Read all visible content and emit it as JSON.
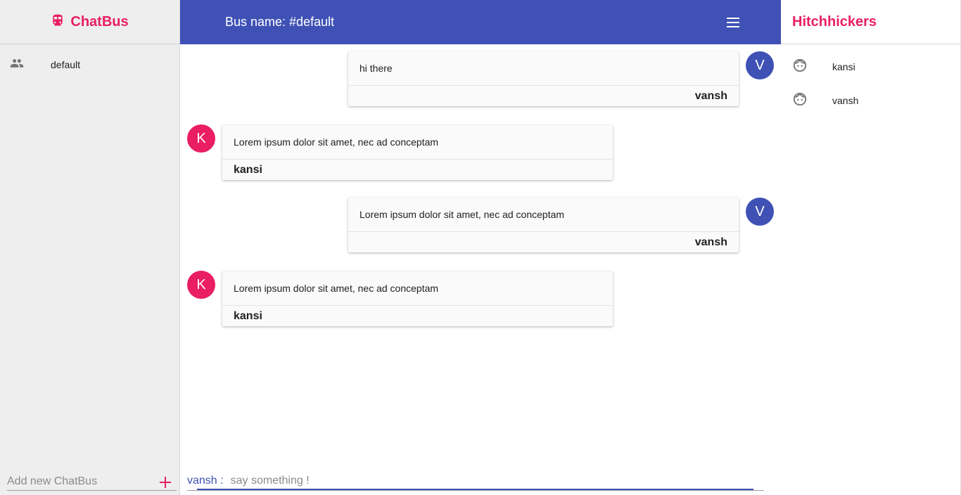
{
  "app": {
    "title": "ChatBus",
    "brand_color": "#e91e63",
    "accent_color": "#3f51b5"
  },
  "sidebar": {
    "buses": [
      {
        "label": "default",
        "icon": "group-icon"
      }
    ],
    "add_bus_placeholder": "Add new ChatBus",
    "add_icon": "plus-icon"
  },
  "header": {
    "bus_name": "Bus name: #default",
    "menu_icon": "hamburger-menu-icon"
  },
  "hitchhikers": {
    "title": "Hitchhickers",
    "users": [
      {
        "name": "kansi",
        "icon": "face-icon"
      },
      {
        "name": "vansh",
        "icon": "face-icon"
      }
    ]
  },
  "messages": [
    {
      "text": "hi there",
      "author": "vansh",
      "initial": "V",
      "self": true
    },
    {
      "text": "Lorem ipsum dolor sit amet, nec ad conceptam",
      "author": "kansi",
      "initial": "K",
      "self": false
    },
    {
      "text": "Lorem ipsum dolor sit amet, nec ad conceptam",
      "author": "vansh",
      "initial": "V",
      "self": true
    },
    {
      "text": "Lorem ipsum dolor sit amet, nec ad conceptam",
      "author": "kansi",
      "initial": "K",
      "self": false
    }
  ],
  "composer": {
    "user_label": "vansh :",
    "placeholder": "say something !"
  }
}
